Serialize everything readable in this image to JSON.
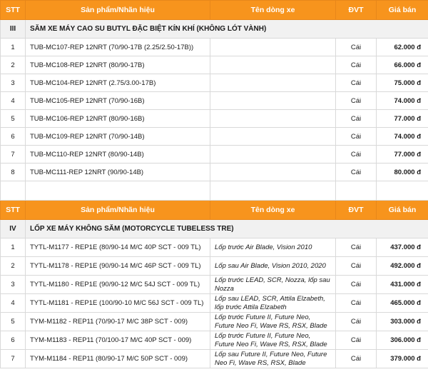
{
  "header": {
    "stt": "STT",
    "product": "Sản phẩm/Nhãn hiệu",
    "model": "Tên dòng xe",
    "unit": "ĐVT",
    "price": "Giá bán"
  },
  "section1": {
    "num": "III",
    "title": "SĂM XE MÁY CAO SU BUTYL ĐẶC BIỆT KÍN KHÍ (KHÔNG LÓT VÀNH)",
    "rows": [
      {
        "stt": "1",
        "product": "TUB-MC107-REP 12NRT (70/90-17B (2.25/2.50-17B))",
        "model": "",
        "unit": "Cái",
        "price": "62.000 đ"
      },
      {
        "stt": "2",
        "product": "TUB-MC108-REP 12NRT (80/90-17B)",
        "model": "",
        "unit": "Cái",
        "price": "66.000 đ"
      },
      {
        "stt": "3",
        "product": "TUB-MC104-REP 12NRT (2.75/3.00-17B)",
        "model": "",
        "unit": "Cái",
        "price": "75.000 đ"
      },
      {
        "stt": "4",
        "product": "TUB-MC105-REP 12NRT (70/90-16B)",
        "model": "",
        "unit": "Cái",
        "price": "74.000 đ"
      },
      {
        "stt": "5",
        "product": "TUB-MC106-REP 12NRT (80/90-16B)",
        "model": "",
        "unit": "Cái",
        "price": "77.000 đ"
      },
      {
        "stt": "6",
        "product": "TUB-MC109-REP 12NRT (70/90-14B)",
        "model": "",
        "unit": "Cái",
        "price": "74.000 đ"
      },
      {
        "stt": "7",
        "product": "TUB-MC110-REP 12NRT (80/90-14B)",
        "model": "",
        "unit": "Cái",
        "price": "77.000 đ"
      },
      {
        "stt": "8",
        "product": "TUB-MC111-REP 12NRT (90/90-14B)",
        "model": "",
        "unit": "Cái",
        "price": "80.000 đ"
      }
    ]
  },
  "section2": {
    "num": "IV",
    "title": "LỐP XE MÁY KHÔNG SĂM (MOTORCYCLE TUBELESS TRE)",
    "rows": [
      {
        "stt": "1",
        "product": "TYTL-M1177 - REP1E (80/90-14 M/C 40P SCT - 009 TL)",
        "model": "Lốp trước Air Blade, Vision 2010",
        "unit": "Cái",
        "price": "437.000 đ"
      },
      {
        "stt": "2",
        "product": "TYTL-M1178 - REP1E (90/90-14 M/C 46P SCT - 009 TL)",
        "model": "Lốp sau Air Blade, Vision 2010, 2020",
        "unit": "Cái",
        "price": "492.000 đ"
      },
      {
        "stt": "3",
        "product": "TYTL-M1180 - REP1E (90/90-12 M/C 54J SCT - 009 TL)",
        "model": "Lốp trước LEAD, SCR, Nozza, lốp sau Nozza",
        "unit": "Cái",
        "price": "431.000 đ"
      },
      {
        "stt": "4",
        "product": "TYTL-M1181 - REP1E (100/90-10 M/C 56J SCT - 009 TL)",
        "model": "Lốp sau LEAD, SCR, Attila Elzabeth, lốp trước Attila Elzabeth",
        "unit": "Cái",
        "price": "465.000 đ"
      },
      {
        "stt": "5",
        "product": "TYM-M1182 - REP11 (70/90-17 M/C 38P SCT - 009)",
        "model": "Lốp trước Future II, Future Neo, Future Neo Fi, Wave RS, RSX, Blade",
        "unit": "Cái",
        "price": "303.000 đ"
      },
      {
        "stt": "6",
        "product": "TYM-M1183 - REP11 (70/100-17 M/C 40P SCT - 009)",
        "model": "Lốp trước Future II, Future Neo, Future Neo Fi, Wave RS, RSX, Blade",
        "unit": "Cái",
        "price": "306.000 đ"
      },
      {
        "stt": "7",
        "product": "TYM-M1184 - REP11 (80/90-17 M/C 50P SCT - 009)",
        "model": "Lốp sau Future II, Future Neo, Future Neo Fi, Wave RS, RSX, Blade",
        "unit": "Cái",
        "price": "379.000 đ"
      }
    ]
  }
}
